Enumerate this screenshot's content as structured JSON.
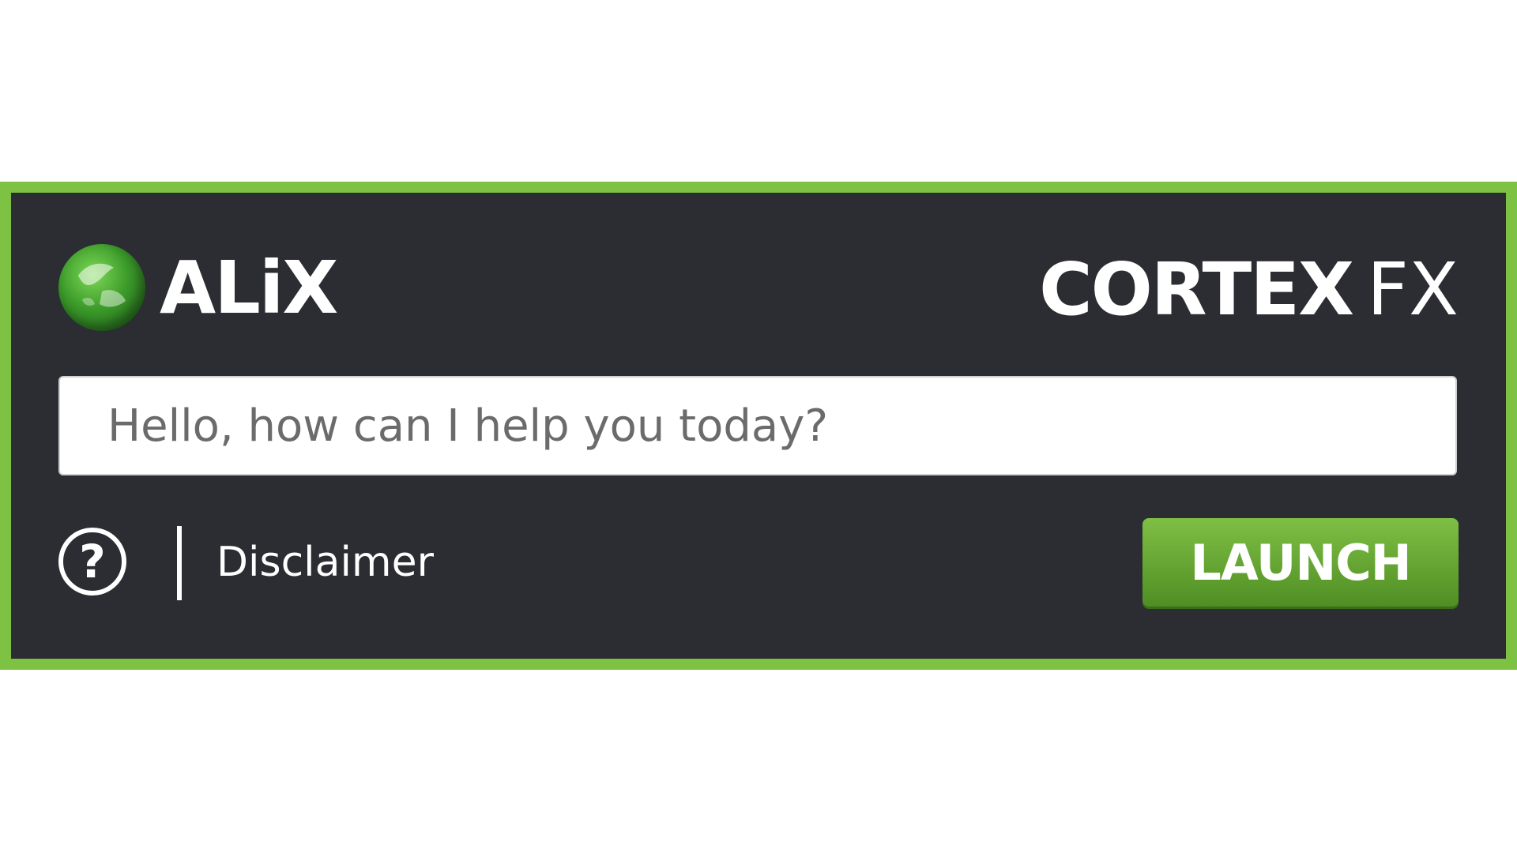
{
  "brand": {
    "left_logo_text": "ALiX",
    "right_logo_main": "CORTEX",
    "right_logo_suffix": "FX"
  },
  "search": {
    "placeholder": "Hello, how can I help you today?"
  },
  "footer": {
    "help_symbol": "?",
    "disclaimer_label": "Disclaimer",
    "launch_label": "LAUNCH"
  },
  "colors": {
    "frame_border": "#7dc242",
    "panel_background": "#2c2c33",
    "launch_button": "#5f9f2f"
  },
  "icons": {
    "left_logo": "globe-logo-icon",
    "help": "question-circle-icon"
  }
}
